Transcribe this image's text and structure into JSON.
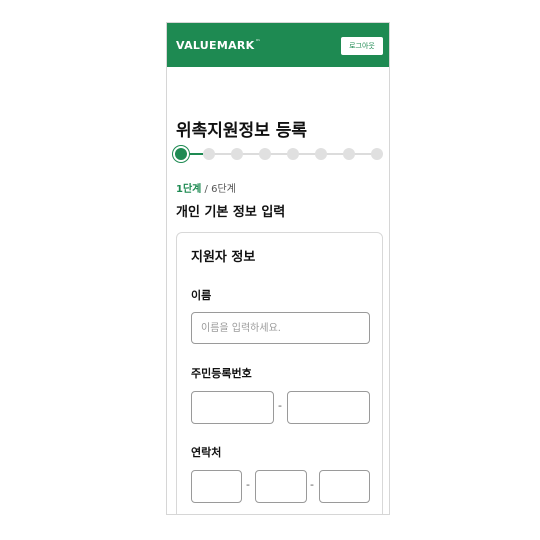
{
  "header": {
    "logo": "VALUEMARK",
    "logo_mark": "™",
    "logout_label": "로그아웃"
  },
  "page": {
    "title": "위촉지원정보 등록"
  },
  "stepper": {
    "total": 8,
    "current": 1
  },
  "step_count": {
    "current": "1단계",
    "separator": " / ",
    "total": "6단계"
  },
  "section_title": "개인 기본 정보 입력",
  "card": {
    "title": "지원자 정보",
    "name": {
      "label": "이름",
      "placeholder": "이름을 입력하세요."
    },
    "rrn": {
      "label": "주민등록번호",
      "dash": "-"
    },
    "phone": {
      "label": "연락처",
      "dash": "-"
    }
  },
  "colors": {
    "brand": "#1e8a52",
    "inactive": "#e0e0e0",
    "border": "#9a9a9a"
  }
}
